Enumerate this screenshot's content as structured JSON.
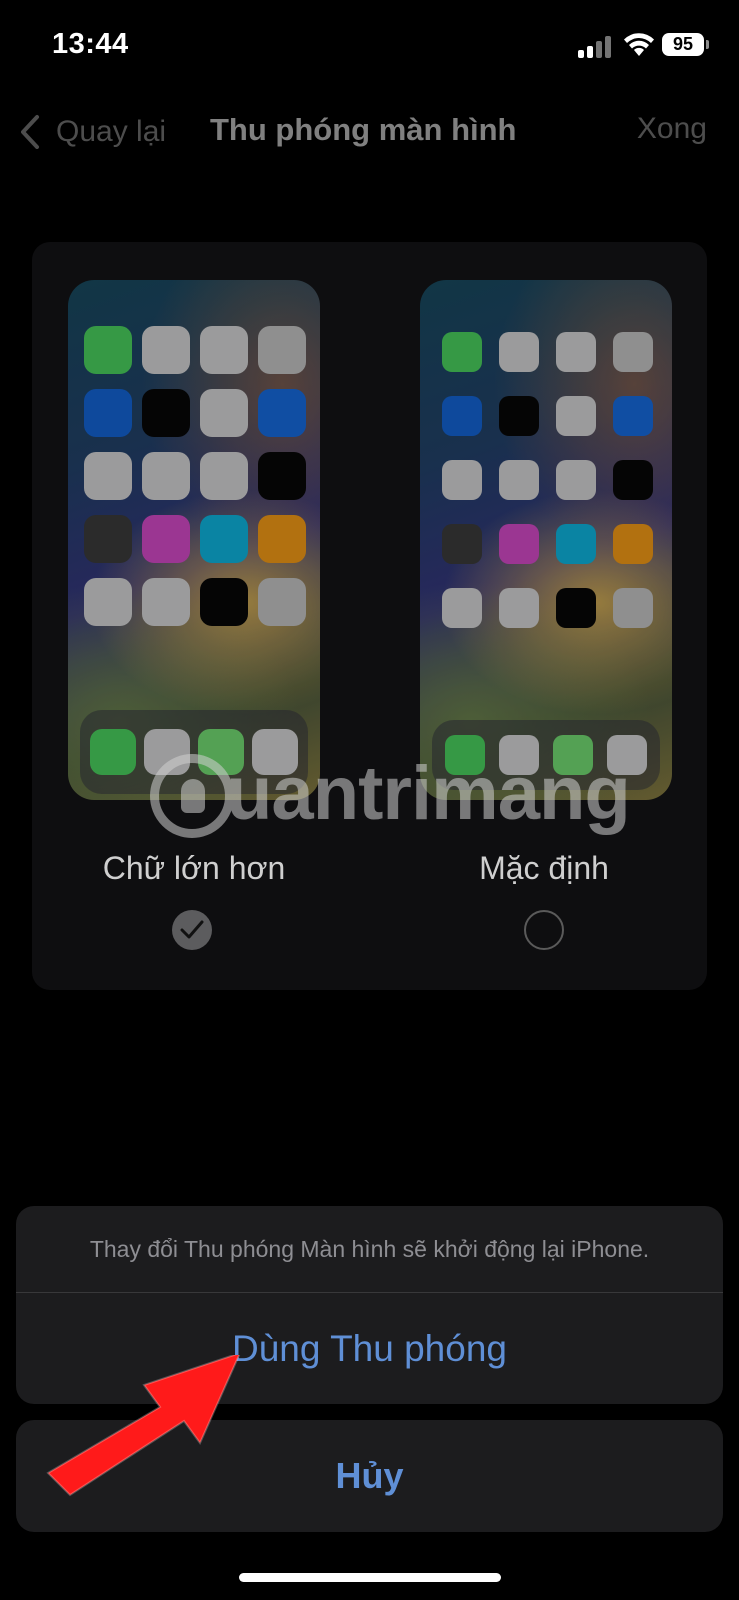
{
  "status_bar": {
    "time": "13:44",
    "battery": "95"
  },
  "nav": {
    "back_label": "Quay lại",
    "title": "Thu phóng màn hình",
    "done_label": "Xong"
  },
  "options": [
    {
      "label": "Chữ lớn hơn",
      "selected": true
    },
    {
      "label": "Mặc định",
      "selected": false
    }
  ],
  "watermark": {
    "text": "uantrimang"
  },
  "action_sheet": {
    "message": "Thay đổi Thu phóng Màn hình sẽ khởi động lại iPhone.",
    "confirm_label": "Dùng Thu phóng",
    "cancel_label": "Hủy"
  },
  "colors": {
    "accent": "#5f8fd6",
    "sheet_background": "#1c1c1e",
    "arrow": "#ff1a1a"
  },
  "app_icon_colors": [
    [
      "#3aa54a",
      "#a8a8a8",
      "#a8a8a8",
      "#9a9a9a"
    ],
    [
      "#0f4fa8",
      "#050505",
      "#a8a8a8",
      "#1154b0"
    ],
    [
      "#a8a8a8",
      "#a8a8a8",
      "#a8a8a8",
      "#050505"
    ],
    [
      "#2e2e2e",
      "#a83a9e",
      "#0a8fb0",
      "#c07a10"
    ],
    [
      "#a8a8a8",
      "#a8a8a8",
      "#050505",
      "#9a9a9a"
    ]
  ],
  "dock_icon_colors": [
    "#3aa54a",
    "#a8a8a8",
    "#5aae5a",
    "#a8a8a8"
  ]
}
